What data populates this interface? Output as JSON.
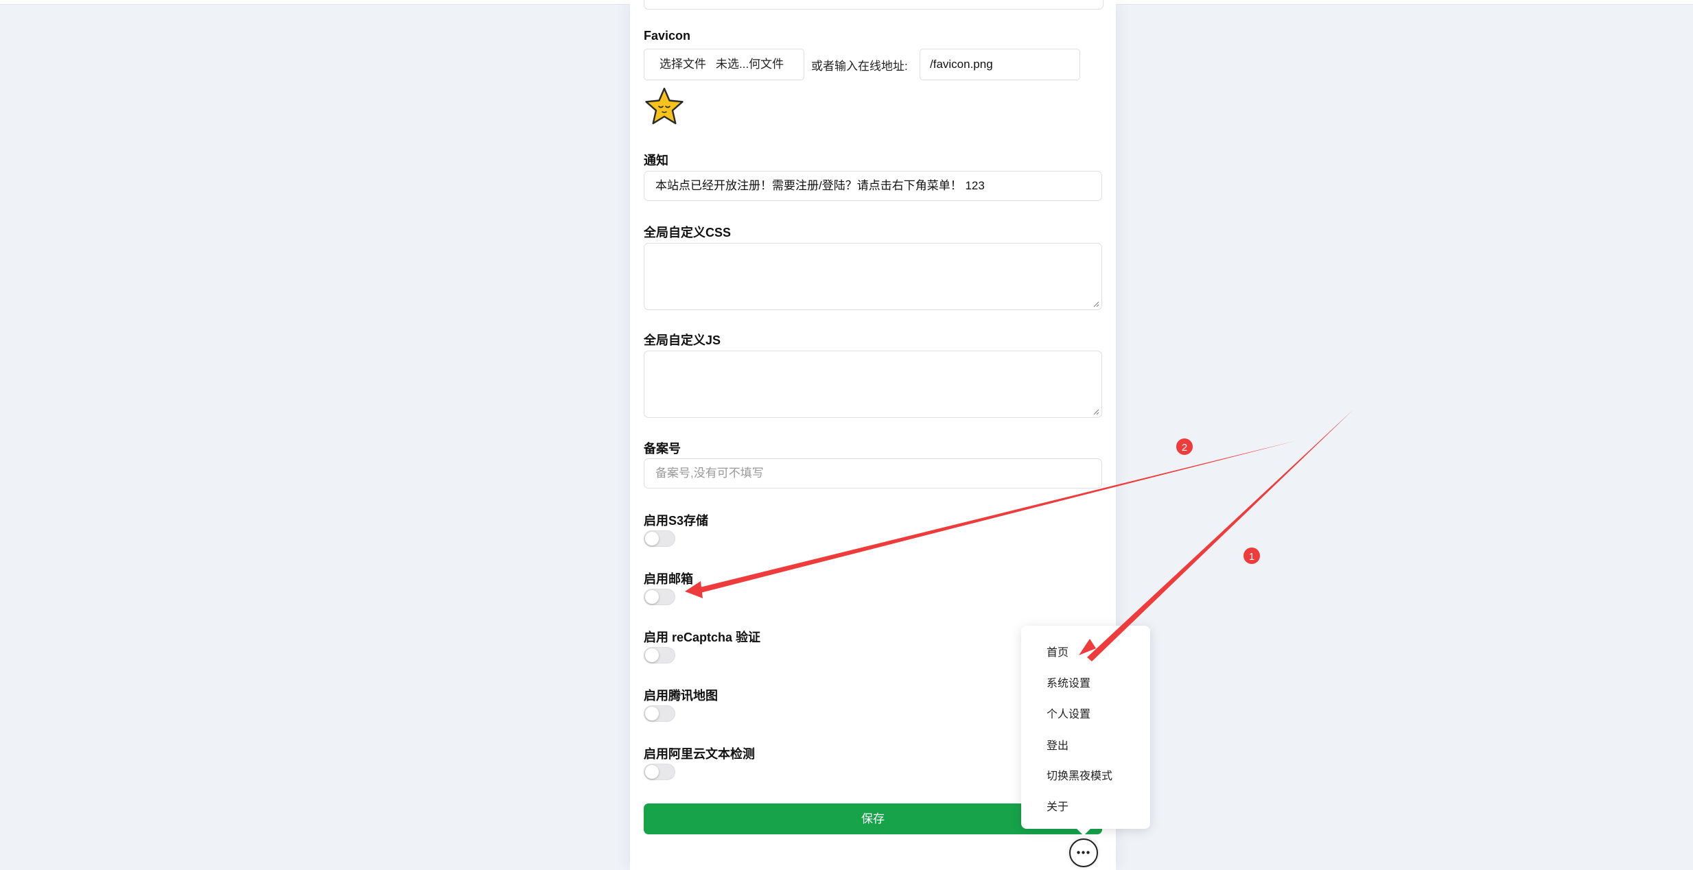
{
  "favicon": {
    "label": "Favicon",
    "file_button_label": "选择文件",
    "file_status": "未选...何文件",
    "or_label": "或者输入在线地址:",
    "url_value": "/favicon.png",
    "preview_icon": "star-face-icon"
  },
  "notice": {
    "label": "通知",
    "value": "本站点已经开放注册！需要注册/登陆？请点击右下角菜单！ 123"
  },
  "custom_css": {
    "label": "全局自定义CSS",
    "value": ""
  },
  "custom_js": {
    "label": "全局自定义JS",
    "value": ""
  },
  "icp": {
    "label": "备案号",
    "placeholder": "备案号,没有可不填写"
  },
  "toggles": [
    {
      "label": "启用S3存储",
      "enabled": false
    },
    {
      "label": "启用邮箱",
      "enabled": false
    },
    {
      "label": "启用 reCaptcha 验证",
      "enabled": false
    },
    {
      "label": "启用腾讯地图",
      "enabled": false
    },
    {
      "label": "启用阿里云文本检测",
      "enabled": false
    }
  ],
  "save_label": "保存",
  "menu": {
    "items": [
      "首页",
      "系统设置",
      "个人设置",
      "登出",
      "切换黑夜模式",
      "关于"
    ],
    "fab_icon": "more-dots-icon"
  },
  "annotations": {
    "badge_1": "1",
    "badge_2": "2"
  },
  "colors": {
    "page_bg": "#eff3f8",
    "save_green": "#16a34a",
    "annotation_red": "#f03a3a"
  }
}
